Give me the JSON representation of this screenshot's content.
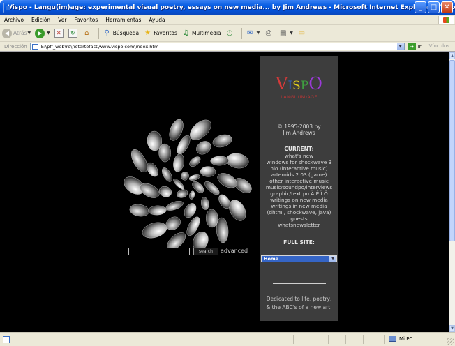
{
  "window": {
    "title": "Vispo - Langu(im)age: experimental visual poetry, essays on new media... by Jim Andrews - Microsoft Internet Explorer - [Trabaj]",
    "buttons": {
      "minimize": "_",
      "maximize": "□",
      "close": "✕"
    }
  },
  "menu": [
    "Archivo",
    "Edición",
    "Ver",
    "Favoritos",
    "Herramientas",
    "Ayuda"
  ],
  "toolbar": {
    "back": "Atrás",
    "search": "Búsqueda",
    "favorites": "Favoritos",
    "multimedia": "Multimedia"
  },
  "address": {
    "label": "Dirección",
    "url": "E:\\pff_web\\re\\netartefact\\www.vispo.com\\index.htm",
    "go": "Ir",
    "links": "Vínculos"
  },
  "page": {
    "logo": {
      "letters": [
        "V",
        "I",
        "S",
        "P",
        "O"
      ]
    },
    "tagline": "LANGU(IM)AGE",
    "copyright": [
      "© 1995-2003 by",
      "Jim Andrews"
    ],
    "current_heading": "CURRENT:",
    "current_items": [
      "what's new",
      "windows for shockwave 3",
      "nio (interactive music)",
      "arteroids 2.03 (game)",
      "other interactive music",
      "music/soundpo/interviews",
      "graphic/text po Ä Ë Ï Ö",
      "writings on new media",
      "writings in new media",
      "(dhtml, shockwave, java)",
      "guests",
      "whatsnewsletter"
    ],
    "full_site_heading": "FULL SITE:",
    "site_select_value": "Home",
    "dedication": [
      "Dedicated to life, poetry,",
      "& the ABC's of a new art."
    ],
    "search_button": "search",
    "advanced_link": "advanced"
  },
  "statusbar": {
    "zone": "Mi PC"
  },
  "colors": {
    "page_bg": "#000000",
    "panel_bg": "#3d3d3d",
    "logo_v": "#d43a3a",
    "logo_i": "#2f61c9",
    "logo_s": "#e1cf1d",
    "logo_p": "#3fa140",
    "logo_o": "#9a3ad7",
    "select_bg": "#3565c6"
  },
  "icons": [
    "app-icon",
    "back-icon",
    "forward-icon",
    "stop-icon",
    "refresh-icon",
    "home-icon",
    "search-icon",
    "favorites-star-icon",
    "multimedia-icon",
    "history-icon",
    "mail-icon",
    "print-icon",
    "edit-icon",
    "folder-icon",
    "page-icon",
    "go-icon",
    "windows-logo-icon",
    "computer-icon"
  ]
}
